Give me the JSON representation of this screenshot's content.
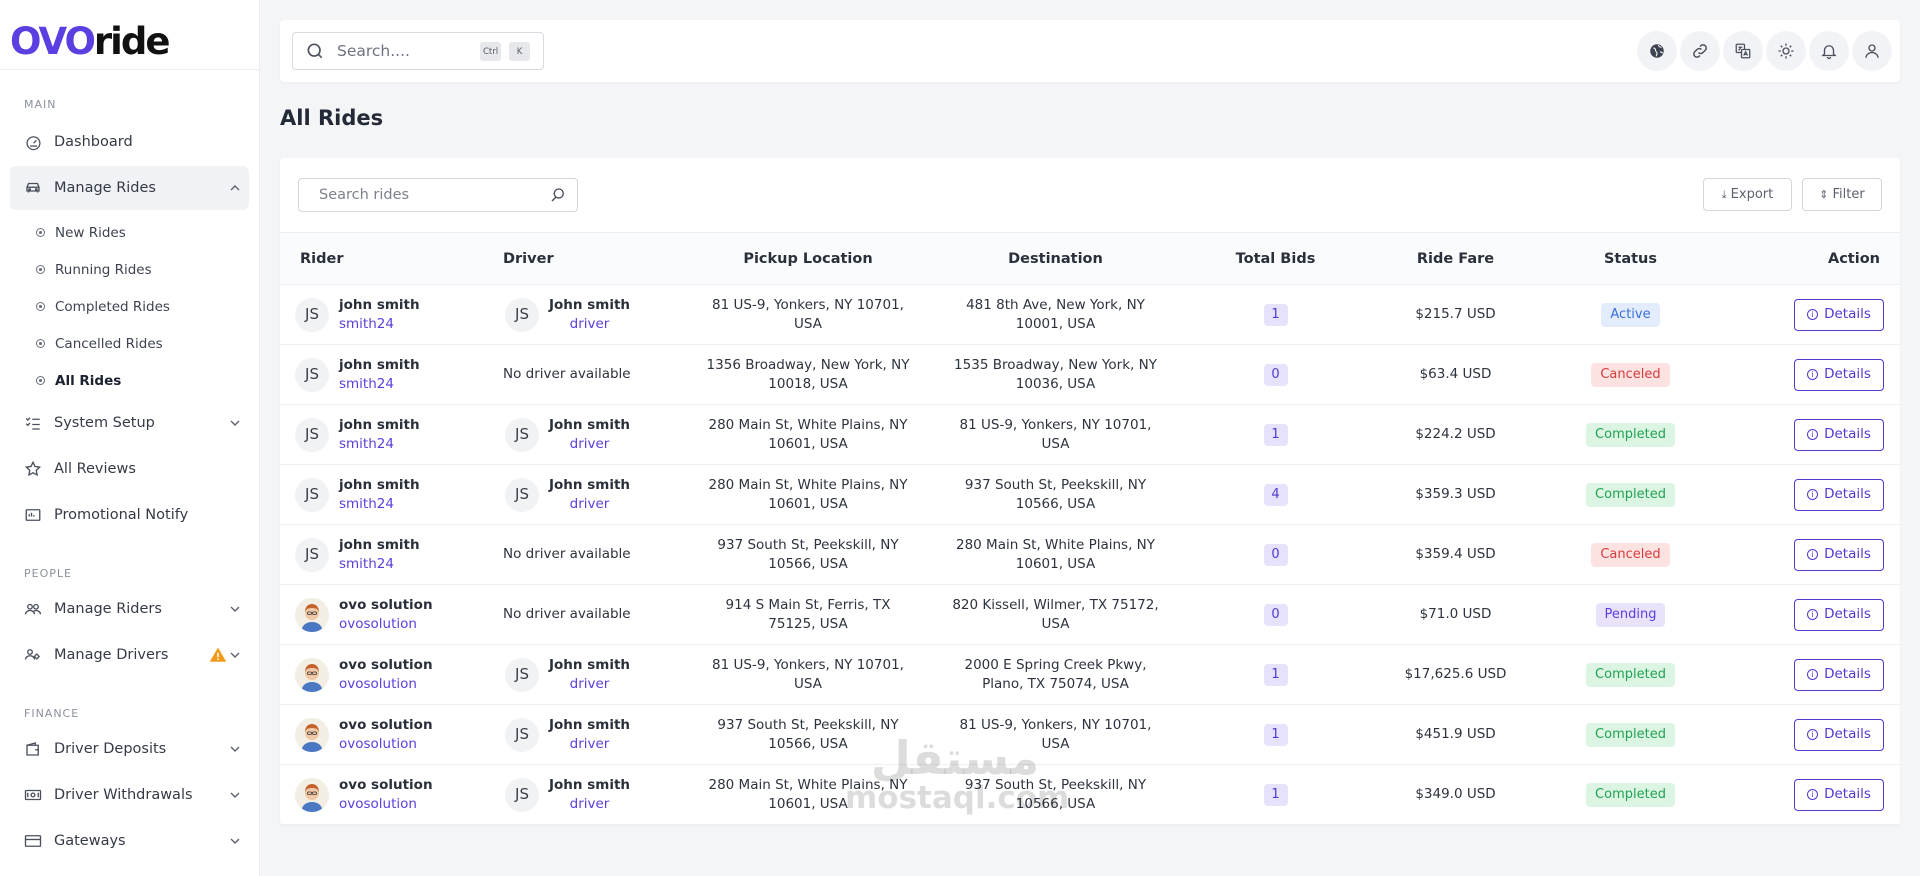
{
  "brand": {
    "name_part1": "OVO",
    "name_part2": "ride",
    "accent": "#5b3fe0"
  },
  "sidebar": {
    "sections": {
      "main": "MAIN",
      "people": "PEOPLE",
      "finance": "FINANCE"
    },
    "items": {
      "dashboard": "Dashboard",
      "manage_rides": "Manage Rides",
      "system_setup": "System Setup",
      "all_reviews": "All Reviews",
      "promotional_notify": "Promotional Notify",
      "manage_riders": "Manage Riders",
      "manage_drivers": "Manage Drivers",
      "driver_deposits": "Driver Deposits",
      "driver_withdrawals": "Driver Withdrawals",
      "gateways": "Gateways"
    },
    "ride_subitems": [
      "New Rides",
      "Running Rides",
      "Completed Rides",
      "Cancelled Rides",
      "All Rides"
    ]
  },
  "topbar": {
    "search_placeholder": "Search....",
    "kbd_ctrl": "Ctrl",
    "kbd_k": "K",
    "icons": [
      "globe-icon",
      "link-icon",
      "translate-icon",
      "sun-icon",
      "bell-icon",
      "user-icon"
    ]
  },
  "page": {
    "title": "All Rides"
  },
  "toolbar": {
    "search_placeholder": "Search rides",
    "export_label": "Export",
    "filter_label": "Filter"
  },
  "table": {
    "headers": [
      "Rider",
      "Driver",
      "Pickup Location",
      "Destination",
      "Total Bids",
      "Ride Fare",
      "Status",
      "Action"
    ],
    "action_label": "Details",
    "rows": [
      {
        "rider_avatar": "JS",
        "rider_name": "john smith",
        "rider_user": "smith24",
        "driver_avatar": "JS",
        "driver_name": "John smith",
        "driver_user": "driver",
        "driver_text": "",
        "pickup": "81 US-9, Yonkers, NY 10701, USA",
        "destination": "481 8th Ave, New York, NY 10001, USA",
        "bids": "1",
        "fare": "$215.7 USD",
        "status": "Active"
      },
      {
        "rider_avatar": "JS",
        "rider_name": "john smith",
        "rider_user": "smith24",
        "driver_avatar": "",
        "driver_name": "",
        "driver_user": "",
        "driver_text": "No driver available",
        "pickup": "1356 Broadway, New York, NY 10018, USA",
        "destination": "1535 Broadway, New York, NY 10036, USA",
        "bids": "0",
        "fare": "$63.4 USD",
        "status": "Canceled"
      },
      {
        "rider_avatar": "JS",
        "rider_name": "john smith",
        "rider_user": "smith24",
        "driver_avatar": "JS",
        "driver_name": "John smith",
        "driver_user": "driver",
        "driver_text": "",
        "pickup": "280 Main St, White Plains, NY 10601, USA",
        "destination": "81 US-9, Yonkers, NY 10701, USA",
        "bids": "1",
        "fare": "$224.2 USD",
        "status": "Completed"
      },
      {
        "rider_avatar": "JS",
        "rider_name": "john smith",
        "rider_user": "smith24",
        "driver_avatar": "JS",
        "driver_name": "John smith",
        "driver_user": "driver",
        "driver_text": "",
        "pickup": "280 Main St, White Plains, NY 10601, USA",
        "destination": "937 South St, Peekskill, NY 10566, USA",
        "bids": "4",
        "fare": "$359.3 USD",
        "status": "Completed"
      },
      {
        "rider_avatar": "JS",
        "rider_name": "john smith",
        "rider_user": "smith24",
        "driver_avatar": "",
        "driver_name": "",
        "driver_user": "",
        "driver_text": "No driver available",
        "pickup": "937 South St, Peekskill, NY 10566, USA",
        "destination": "280 Main St, White Plains, NY 10601, USA",
        "bids": "0",
        "fare": "$359.4 USD",
        "status": "Canceled"
      },
      {
        "rider_avatar": "",
        "rider_name": "ovo solution",
        "rider_user": "ovosolution",
        "driver_avatar": "",
        "driver_name": "",
        "driver_user": "",
        "driver_text": "No driver available",
        "pickup": "914 S Main St, Ferris, TX 75125, USA",
        "destination": "820 Kissell, Wilmer, TX 75172, USA",
        "bids": "0",
        "fare": "$71.0 USD",
        "status": "Pending"
      },
      {
        "rider_avatar": "",
        "rider_name": "ovo solution",
        "rider_user": "ovosolution",
        "driver_avatar": "JS",
        "driver_name": "John smith",
        "driver_user": "driver",
        "driver_text": "",
        "pickup": "81 US-9, Yonkers, NY 10701, USA",
        "destination": "2000 E Spring Creek Pkwy, Plano, TX 75074, USA",
        "bids": "1",
        "fare": "$17,625.6 USD",
        "status": "Completed"
      },
      {
        "rider_avatar": "",
        "rider_name": "ovo solution",
        "rider_user": "ovosolution",
        "driver_avatar": "JS",
        "driver_name": "John smith",
        "driver_user": "driver",
        "driver_text": "",
        "pickup": "937 South St, Peekskill, NY 10566, USA",
        "destination": "81 US-9, Yonkers, NY 10701, USA",
        "bids": "1",
        "fare": "$451.9 USD",
        "status": "Completed"
      },
      {
        "rider_avatar": "",
        "rider_name": "ovo solution",
        "rider_user": "ovosolution",
        "driver_avatar": "JS",
        "driver_name": "John smith",
        "driver_user": "driver",
        "driver_text": "",
        "pickup": "280 Main St, White Plains, NY 10601, USA",
        "destination": "937 South St, Peekskill, NY 10566, USA",
        "bids": "1",
        "fare": "$349.0 USD",
        "status": "Completed"
      }
    ]
  },
  "status_colors": {
    "Active": {
      "bg": "#e3ecfd",
      "fg": "#3b6fd9"
    },
    "Canceled": {
      "bg": "#fde2e2",
      "fg": "#d63c3c"
    },
    "Completed": {
      "bg": "#dcf5e3",
      "fg": "#23a156"
    },
    "Pending": {
      "bg": "#e8e3fb",
      "fg": "#5b3fe0"
    }
  },
  "watermark": {
    "line1": "مستقل",
    "line2": "mostaql.com"
  }
}
